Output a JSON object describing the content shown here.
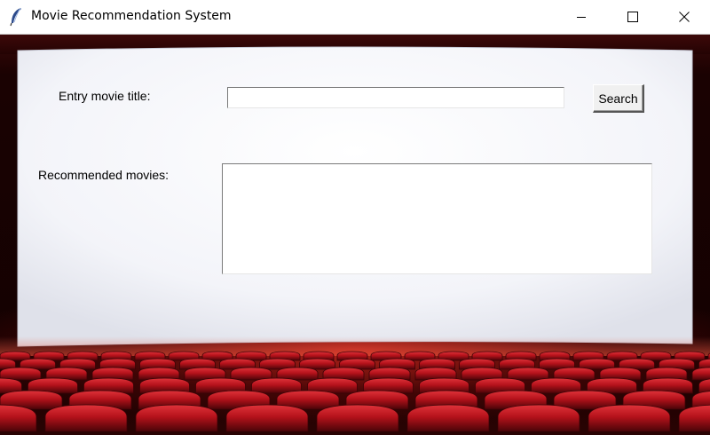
{
  "window": {
    "title": "Movie Recommendation System",
    "app_icon": "feather-icon",
    "controls": [
      "minimize-icon",
      "maximize-icon",
      "close-icon"
    ]
  },
  "form": {
    "entry_label": "Entry movie title:",
    "entry_value": "",
    "search_label": "Search",
    "recommended_label": "Recommended movies:",
    "recommended_text": ""
  },
  "colors": {
    "screen": "#f4f5fa",
    "seat_red": "#b5121b",
    "seat_dark": "#3a0306",
    "titlebar": "#ffffff"
  }
}
